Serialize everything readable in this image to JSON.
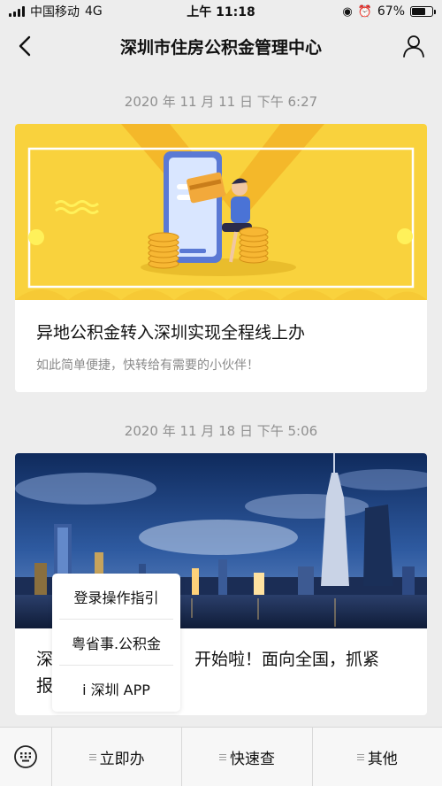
{
  "status_bar": {
    "carrier": "中国移动",
    "network": "4G",
    "time": "上午 11:18",
    "battery_percent": "67%",
    "battery_level": 0.67,
    "icons": [
      "signal-icon",
      "location-icon",
      "alarm-icon",
      "battery-icon"
    ]
  },
  "nav": {
    "title": "深圳市住房公积金管理中心",
    "back_icon": "chevron-left-icon",
    "profile_icon": "person-icon"
  },
  "messages": [
    {
      "timestamp": "2020 年 11 月 11 日  下午 6:27",
      "title": "异地公积金转入深圳实现全程线上办",
      "description": "如此简单便捷，快转给有需要的小伙伴！",
      "image": "yellow-illustration-phone-card"
    },
    {
      "timestamp": "2020 年 11 月 18 日  下午 5:06",
      "title_left": "深",
      "title_right": "开始啦！面向全国，抓紧",
      "title_line2": "报",
      "image": "shenzhen-night-skyline"
    }
  ],
  "popup_menu": {
    "items": [
      "登录操作指引",
      "粤省事.公积金",
      "i 深圳 APP"
    ]
  },
  "bottom_menu": {
    "keyboard_icon": "keyboard-icon",
    "items": [
      "立即办",
      "快速查",
      "其他"
    ]
  },
  "colors": {
    "background": "#ededed",
    "banner_yellow": "#f9d23d",
    "night_sky": "#1d3f7a"
  }
}
